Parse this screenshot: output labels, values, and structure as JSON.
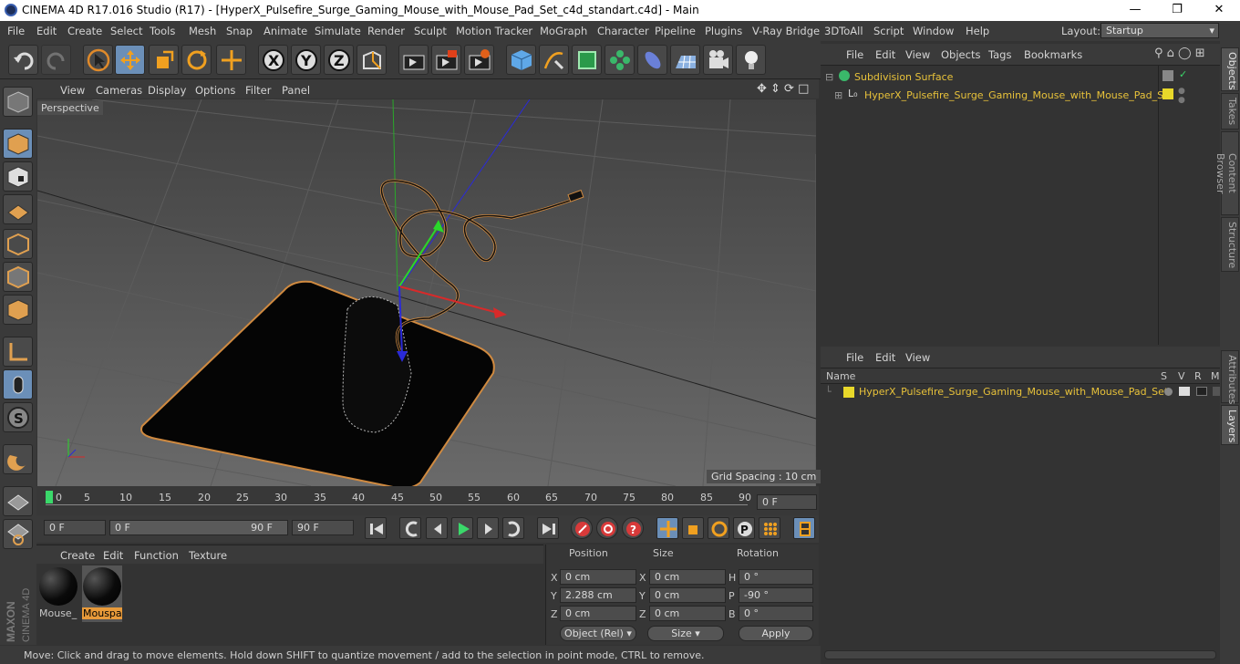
{
  "window": {
    "title": "CINEMA 4D R17.016 Studio (R17) - [HyperX_Pulsefire_Surge_Gaming_Mouse_with_Mouse_Pad_Set_c4d_standart.c4d] - Main"
  },
  "menubar": {
    "items": [
      "File",
      "Edit",
      "Create",
      "Select",
      "Tools",
      "Mesh",
      "Snap",
      "Animate",
      "Simulate",
      "Render",
      "Sculpt",
      "Motion Tracker",
      "MoGraph",
      "Character",
      "Pipeline",
      "Plugins",
      "V-Ray Bridge",
      "3DToAll",
      "Script",
      "Window",
      "Help"
    ],
    "layout_label": "Layout:",
    "layout_value": "Startup"
  },
  "viewport": {
    "menu": [
      "View",
      "Cameras",
      "Display",
      "Options",
      "Filter",
      "Panel"
    ],
    "camera": "Perspective",
    "grid_spacing": "Grid Spacing : 10 cm"
  },
  "timeline": {
    "ticks": [
      "0",
      "5",
      "10",
      "15",
      "20",
      "25",
      "30",
      "35",
      "40",
      "45",
      "50",
      "55",
      "60",
      "65",
      "70",
      "75",
      "80",
      "85",
      "90"
    ],
    "current_frame": "0 F"
  },
  "transport": {
    "start": "0 F",
    "range_start": "0 F",
    "range_end": "90 F",
    "end": "90 F"
  },
  "materials": {
    "menu": [
      "Create",
      "Edit",
      "Function",
      "Texture"
    ],
    "items": [
      "Mouse_",
      "Mouspa"
    ]
  },
  "coords": {
    "headers": [
      "Position",
      "Size",
      "Rotation"
    ],
    "rows": [
      {
        "axis": "X",
        "pos": "0 cm",
        "saxis": "X",
        "size": "0 cm",
        "raxis": "H",
        "rot": "0 °"
      },
      {
        "axis": "Y",
        "pos": "2.288 cm",
        "saxis": "Y",
        "size": "0 cm",
        "raxis": "P",
        "rot": "-90 °"
      },
      {
        "axis": "Z",
        "pos": "0 cm",
        "saxis": "Z",
        "size": "0 cm",
        "raxis": "B",
        "rot": "0 °"
      }
    ],
    "mode": "Object (Rel)",
    "size_mode": "Size",
    "apply": "Apply"
  },
  "objects": {
    "menu": [
      "File",
      "Edit",
      "View",
      "Objects",
      "Tags",
      "Bookmarks"
    ],
    "items": [
      "Subdivision Surface",
      "HyperX_Pulsefire_Surge_Gaming_Mouse_with_Mouse_Pad_Set"
    ]
  },
  "layers": {
    "menu": [
      "File",
      "Edit",
      "View"
    ],
    "header": {
      "name": "Name",
      "s": "S",
      "v": "V",
      "r": "R",
      "m": "M"
    },
    "items": [
      "HyperX_Pulsefire_Surge_Gaming_Mouse_with_Mouse_Pad_Set"
    ]
  },
  "right_tabs": [
    "Objects",
    "Takes",
    "Content Browser",
    "Structure",
    "Attributes",
    "Layers"
  ],
  "status": "Move: Click and drag to move elements. Hold down SHIFT to quantize movement / add to the selection in point mode, CTRL to remove.",
  "brand": [
    "MAXON",
    "CINEMA 4D"
  ],
  "colors": {
    "accent": "#6b8fb8",
    "object_name": "#e8c23a",
    "selected": "#e89a3a"
  }
}
